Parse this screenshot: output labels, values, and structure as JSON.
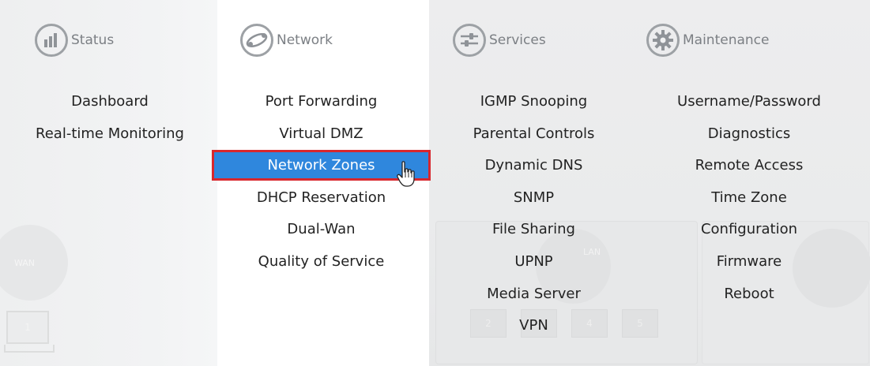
{
  "columns": [
    {
      "title": "Status",
      "icon": "bar-chart-icon",
      "items": [
        "Dashboard",
        "Real-time Monitoring"
      ]
    },
    {
      "title": "Network",
      "icon": "network-orbit-icon",
      "items": [
        "Port Forwarding",
        "Virtual DMZ",
        "Network Zones",
        "DHCP Reservation",
        "Dual-Wan",
        "Quality of Service"
      ],
      "active_index": 2
    },
    {
      "title": "Services",
      "icon": "sliders-icon",
      "items": [
        "IGMP Snooping",
        "Parental Controls",
        "Dynamic DNS",
        "SNMP",
        "File Sharing",
        "UPNP",
        "Media Server",
        "VPN"
      ]
    },
    {
      "title": "Maintenance",
      "icon": "gear-icon",
      "items": [
        "Username/Password",
        "Diagnostics",
        "Remote Access",
        "Time Zone",
        "Configuration",
        "Firmware",
        "Reboot"
      ]
    }
  ],
  "background": {
    "wan_label": "WAN",
    "lan_label": "LAN",
    "port_labels": [
      "1",
      "2",
      "3",
      "4",
      "5"
    ]
  },
  "colors": {
    "active_bg": "#2f87dd",
    "active_border": "#d8272d",
    "header_text": "#7b7f84",
    "icon_stroke": "#9da1a5"
  }
}
